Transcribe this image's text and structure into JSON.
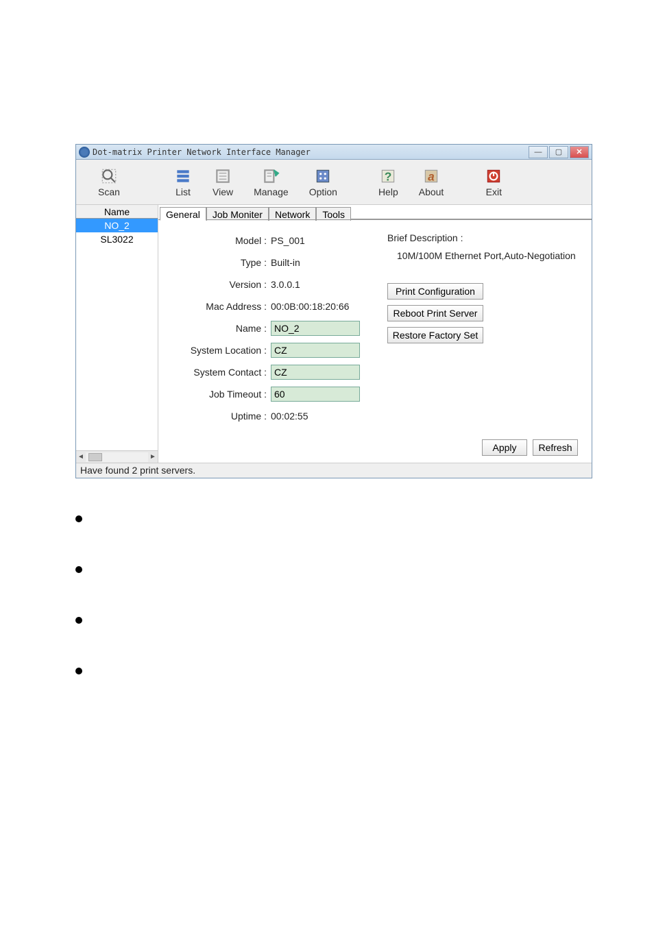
{
  "window": {
    "title": "Dot-matrix Printer Network Interface Manager"
  },
  "toolbar": {
    "scan": "Scan",
    "list": "List",
    "view": "View",
    "manage": "Manage",
    "option": "Option",
    "help": "Help",
    "about": "About",
    "exit": "Exit"
  },
  "sidebar": {
    "header": "Name",
    "items": [
      {
        "label": "NO_2",
        "selected": true
      },
      {
        "label": "SL3022",
        "selected": false
      }
    ]
  },
  "tabs": [
    {
      "label": "General",
      "active": true
    },
    {
      "label": "Job Moniter",
      "active": false
    },
    {
      "label": "Network",
      "active": false
    },
    {
      "label": "Tools",
      "active": false
    }
  ],
  "general": {
    "model_label": "Model :",
    "model_value": "PS_001",
    "type_label": "Type :",
    "type_value": "Built-in",
    "version_label": "Version :",
    "version_value": "3.0.0.1",
    "mac_label": "Mac Address :",
    "mac_value": "00:0B:00:18:20:66",
    "name_label": "Name :",
    "name_value": "NO_2",
    "syslocation_label": "System Location :",
    "syslocation_value": "CZ",
    "syscontact_label": "System Contact :",
    "syscontact_value": "CZ",
    "jobtimeout_label": "Job Timeout :",
    "jobtimeout_value": "60",
    "uptime_label": "Uptime :",
    "uptime_value": "00:02:55",
    "desc_label": "Brief Description :",
    "desc_text": "10M/100M Ethernet Port,Auto-Negotiation"
  },
  "buttons": {
    "print_config": "Print Configuration",
    "reboot": "Reboot Print Server",
    "restore": "Restore Factory Set",
    "apply": "Apply",
    "refresh": "Refresh"
  },
  "statusbar": "Have found 2 print servers."
}
